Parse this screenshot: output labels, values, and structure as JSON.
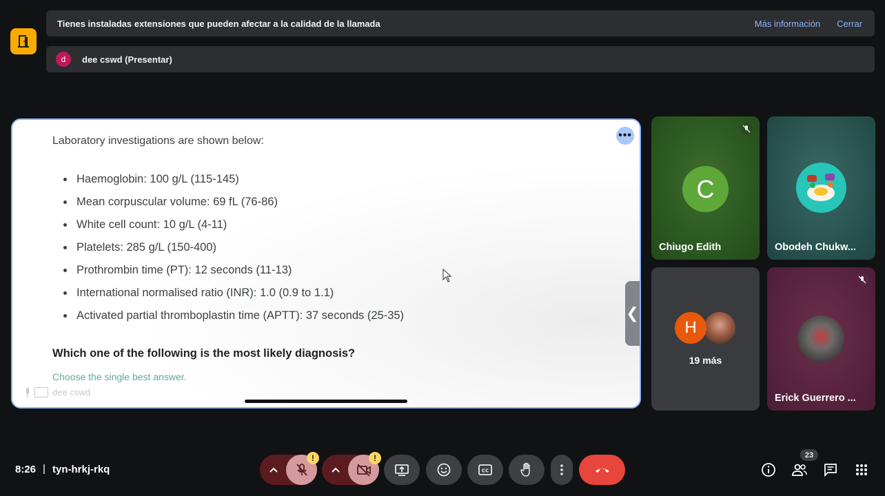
{
  "banners": {
    "extensions_message": "Tienes instaladas extensiones que pueden afectar a la calidad de la llamada",
    "more_info": "Más información",
    "close": "Cerrar",
    "presenter_initial": "d",
    "presenter_label": "dee cswd (Presentar)"
  },
  "presentation": {
    "heading": "Laboratory investigations are shown below:",
    "labs": [
      "Haemoglobin: 100 g/L (115-145)",
      "Mean corpuscular volume: 69 fL (76-86)",
      "White cell count: 10 g/L (4-11)",
      "Platelets: 285 g/L (150-400)",
      "Prothrombin time (PT): 12 seconds (11-13)",
      "International normalised ratio (INR): 1.0 (0.9 to 1.1)",
      "Activated partial thromboplastin time (APTT): 37 seconds (25-35)"
    ],
    "question": "Which one of the following is the most likely diagnosis?",
    "instruction": "Choose the single best answer.",
    "presenter_name": "dee cswd",
    "more_glyph": "•••",
    "collapse_glyph": "❮"
  },
  "participants": {
    "tile1": {
      "initial": "C",
      "name": "Chiugo Edith",
      "muted": true
    },
    "tile2": {
      "name": "Obodeh Chukw..."
    },
    "tile3": {
      "initial": "H",
      "more": "19 más"
    },
    "tile4": {
      "name": "Erick Guerrero ...",
      "muted": true
    }
  },
  "bottom": {
    "time": "8:26",
    "separator": "|",
    "meeting_code": "tyn-hrkj-rkq",
    "warn_glyph": "!",
    "people_count": "23"
  },
  "icons": {
    "door": "door-icon",
    "mic_off": "mic-off-icon",
    "cam_off": "camera-off-icon",
    "present": "present-screen-icon",
    "emoji": "emoji-icon",
    "captions": "captions-icon",
    "hand": "raise-hand-icon",
    "more": "more-vert-icon",
    "end": "end-call-icon",
    "info": "info-icon",
    "people": "people-icon",
    "chat": "chat-icon",
    "apps": "apps-grid-icon"
  },
  "colors": {
    "accent": "#8ab4f8",
    "end_call": "#e8453c",
    "warning": "#fdd663",
    "muted_control": "#d49a9d"
  }
}
